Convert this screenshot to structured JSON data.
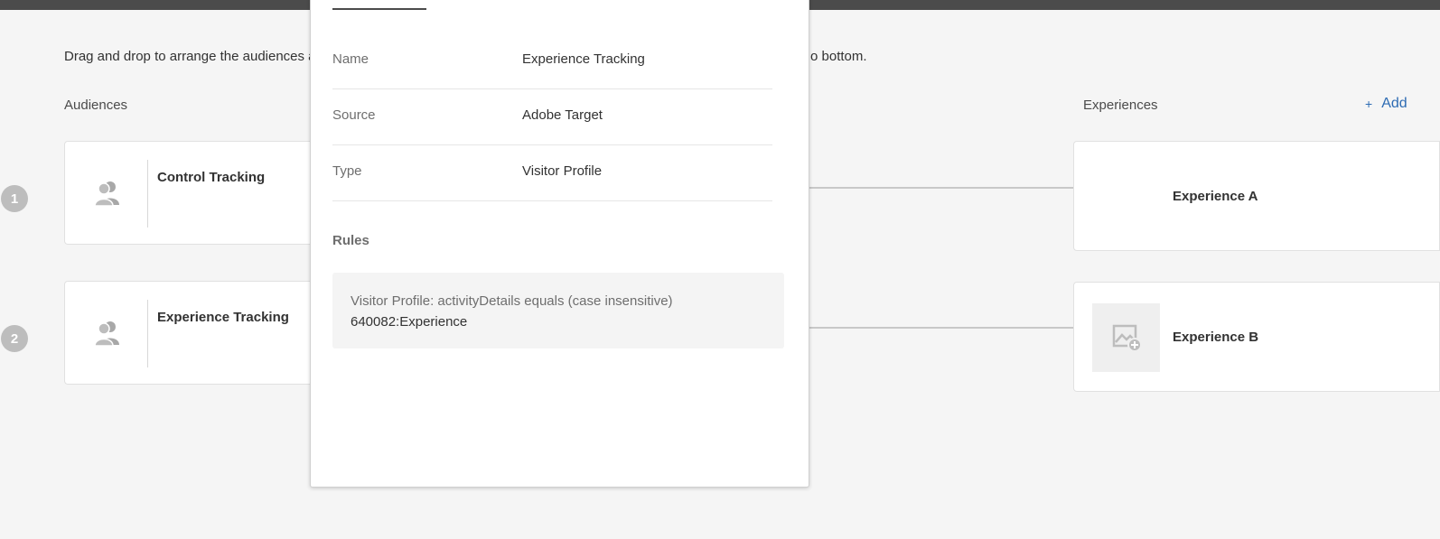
{
  "instructions": {
    "start": "Drag and drop to arrange the audiences a",
    "end": "o bottom."
  },
  "columns": {
    "audiences_label": "Audiences",
    "experiences_label": "Experiences",
    "add_label": "Add",
    "add_icon": "plus-icon"
  },
  "audiences": [
    {
      "step": "1",
      "name": "Control Tracking",
      "icon": "users-icon"
    },
    {
      "step": "2",
      "name": "Experience Tracking",
      "icon": "users-icon"
    }
  ],
  "experiences": [
    {
      "name": "Experience A"
    },
    {
      "name": "Experience B",
      "icon": "add-image-icon"
    }
  ],
  "popover": {
    "fields": [
      {
        "label": "Name",
        "value": "Experience Tracking"
      },
      {
        "label": "Source",
        "value": "Adobe Target"
      },
      {
        "label": "Type",
        "value": "Visitor Profile"
      }
    ],
    "rules_heading": "Rules",
    "rule": {
      "condition": "Visitor Profile: activityDetails equals (case insensitive)",
      "value": "640082:Experience"
    }
  },
  "colors": {
    "link": "#2d6bb3",
    "topbar": "#4b4b4b",
    "background": "#f5f5f5"
  }
}
